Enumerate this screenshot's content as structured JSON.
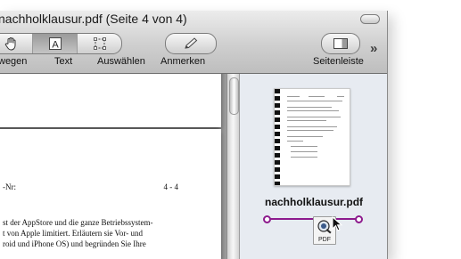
{
  "window": {
    "title": "nachholklausur.pdf (Seite 4 von 4)"
  },
  "toolbar": {
    "tools": [
      {
        "label": "Bewegen",
        "icon": "hand-icon",
        "visible_label": "wegen"
      },
      {
        "label": "Text",
        "icon": "text-select-icon"
      },
      {
        "label": "Auswählen",
        "icon": "marquee-select-icon"
      },
      {
        "label": "Anmerken",
        "icon": "pencil-icon"
      },
      {
        "label": "Seitenleiste",
        "icon": "sidebar-icon"
      }
    ],
    "overflow_label": "»"
  },
  "document": {
    "page_text": {
      "nr_label": "-Nr:",
      "page_ref": "4 - 4",
      "lines": [
        "st der AppStore und die ganze Betriebssystem-",
        "t von Apple limitiert. Erläutern sie Vor- und",
        "roid und iPhone OS) und begründen Sie Ihre"
      ]
    }
  },
  "sidebar": {
    "thumbnail_filename": "nachholklausur.pdf",
    "drag_icon_label": "PDF"
  },
  "colors": {
    "selection": "#8d1a8d",
    "sidebar_bg": "#e7ebf1"
  }
}
